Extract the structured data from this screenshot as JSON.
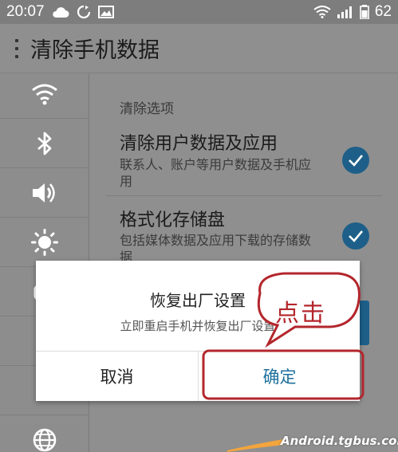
{
  "status_bar": {
    "time": "20:07",
    "battery": "62",
    "left_icons": [
      "cloud-icon",
      "sync-icon",
      "image-icon"
    ],
    "right_icons": [
      "wifi-icon",
      "signal-icon",
      "battery-icon"
    ]
  },
  "app_bar": {
    "title": "清除手机数据"
  },
  "sidebar": {
    "items": [
      {
        "icon": "wifi-icon"
      },
      {
        "icon": "bluetooth-icon"
      },
      {
        "icon": "volume-icon"
      },
      {
        "icon": "brightness-icon"
      },
      {
        "icon": "apps-icon"
      },
      {
        "icon": "storage-icon"
      },
      {
        "icon": "location-icon"
      },
      {
        "icon": "globe-icon"
      }
    ]
  },
  "content": {
    "section_title": "清除选项",
    "options": [
      {
        "title": "清除用户数据及应用",
        "desc": "联系人、账户等用户数据及手机应用",
        "checked": true
      },
      {
        "title": "格式化存储盘",
        "desc": "包括媒体数据及应用下载的存储数据",
        "checked": true
      }
    ]
  },
  "dialog": {
    "title": "恢复出厂设置",
    "message": "立即重启手机并恢复出厂设置",
    "cancel_label": "取消",
    "confirm_label": "确定"
  },
  "annotation": {
    "callout_text": "点击",
    "color": "#b3262c"
  },
  "watermark": {
    "text": "Android.tgbus.com"
  },
  "colors": {
    "accent": "#1d5f89",
    "confirm_text": "#1d6f9c",
    "overlay": "#8e8e8e"
  }
}
